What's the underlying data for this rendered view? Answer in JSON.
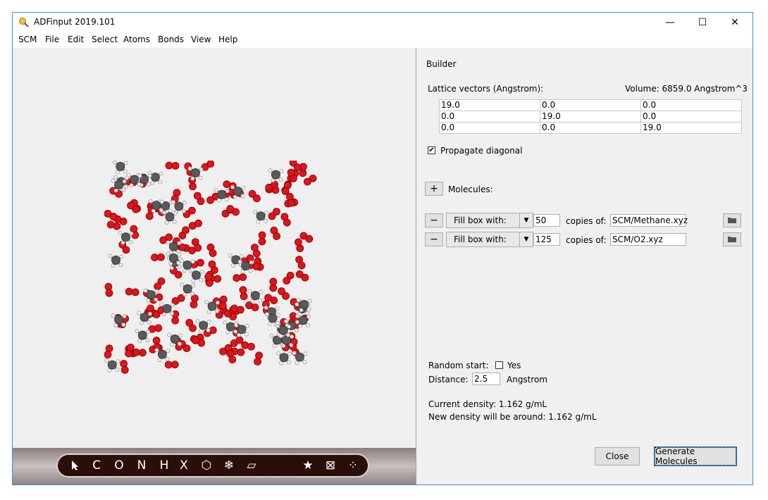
{
  "window": {
    "title": "ADFinput 2019.101",
    "min_label": "—",
    "max_label": "☐",
    "close_label": "✕"
  },
  "menu": [
    {
      "label": "SCM"
    },
    {
      "label": "File"
    },
    {
      "label": "Edit"
    },
    {
      "label": "Select"
    },
    {
      "label": "Atoms"
    },
    {
      "label": "Bonds"
    },
    {
      "label": "View"
    },
    {
      "label": "Help"
    }
  ],
  "toolbar": {
    "items": [
      "C",
      "O",
      "N",
      "H",
      "X",
      "⬡",
      "❄",
      "▱",
      "★",
      "⊠",
      "⁘"
    ]
  },
  "builder": {
    "title": "Builder",
    "lattice_label": "Lattice vectors (Angstrom):",
    "volume": "Volume: 6859.0 Angstrom^3",
    "lattice": [
      [
        "19.0",
        "0.0",
        "0.0"
      ],
      [
        "0.0",
        "19.0",
        "0.0"
      ],
      [
        "0.0",
        "0.0",
        "19.0"
      ]
    ],
    "propagate_label": "Propagate diagonal",
    "propagate_checked": "✔",
    "molecules_label": "Molecules:",
    "add_label": "+",
    "remove_label": "−",
    "rows": [
      {
        "mode": "Fill box with:",
        "count": "50",
        "copies_label": "copies of:",
        "file": "SCM/Methane.xyz"
      },
      {
        "mode": "Fill box with:",
        "count": "125",
        "copies_label": "copies of:",
        "file": "SCM/O2.xyz"
      }
    ],
    "random_label": "Random start:",
    "random_yes": "Yes",
    "distance_label": "Distance:",
    "distance_value": "2.5",
    "distance_unit": "Angstrom",
    "current_density": "Current density: 1.162 g/mL",
    "new_density": "New density will be around: 1.162 g/mL",
    "close_button": "Close",
    "generate_button": "Generate Molecules"
  },
  "colors": {
    "oxygen": "#e0141a",
    "carbon": "#5a5a5a",
    "hydrogen": "#f5f5f5",
    "toolbar": "#2a0e0a"
  }
}
